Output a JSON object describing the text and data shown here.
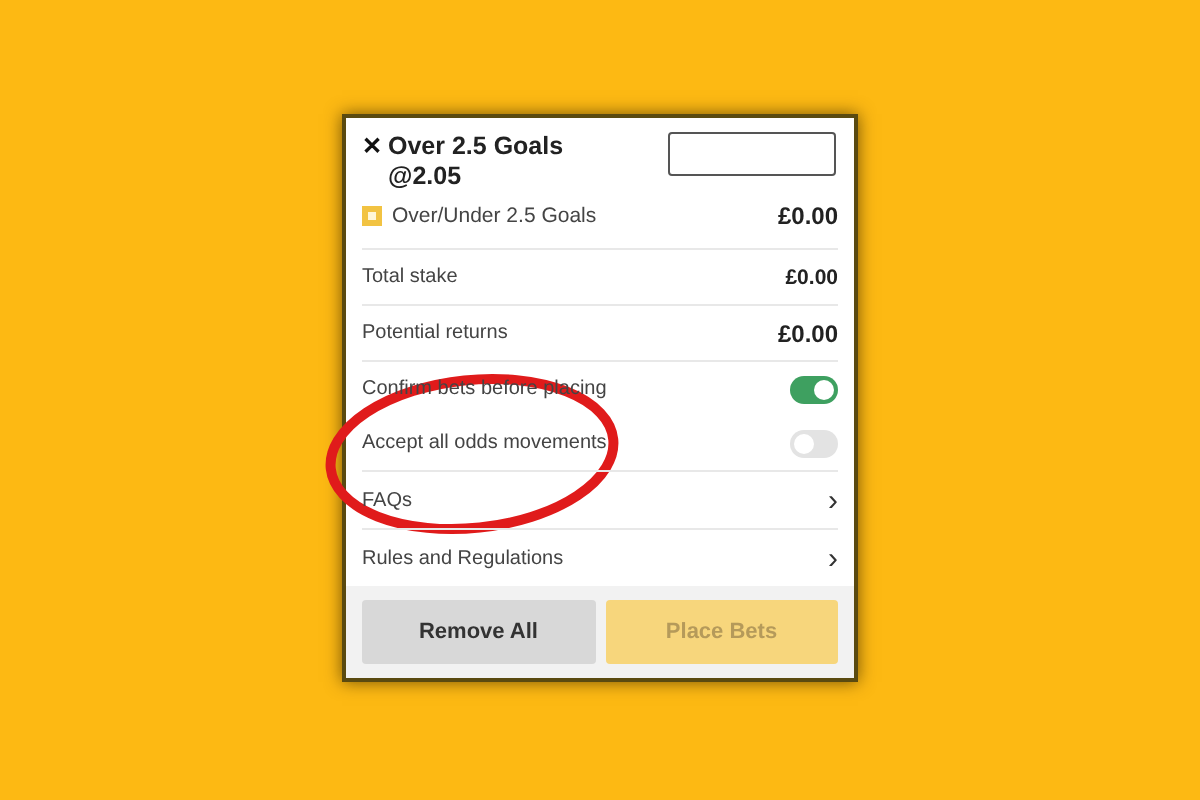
{
  "bet": {
    "close_icon": "✕",
    "selection": "Over 2.5 Goals",
    "odds": "@2.05",
    "market": "Over/Under 2.5 Goals",
    "amount": "£0.00"
  },
  "summary": [
    {
      "label": "Total stake",
      "value": "£0.00"
    },
    {
      "label": "Potential returns",
      "value": "£0.00"
    }
  ],
  "settings": [
    {
      "label": "Confirm bets before placing",
      "on": true
    },
    {
      "label": "Accept all odds movements",
      "on": false
    }
  ],
  "links": [
    {
      "label": "FAQs",
      "chevron": "›"
    },
    {
      "label": "Rules and Regulations",
      "chevron": "›"
    }
  ],
  "buttons": [
    {
      "label": "Remove All",
      "disabled": false
    },
    {
      "label": "Place Bets",
      "disabled": true
    }
  ]
}
